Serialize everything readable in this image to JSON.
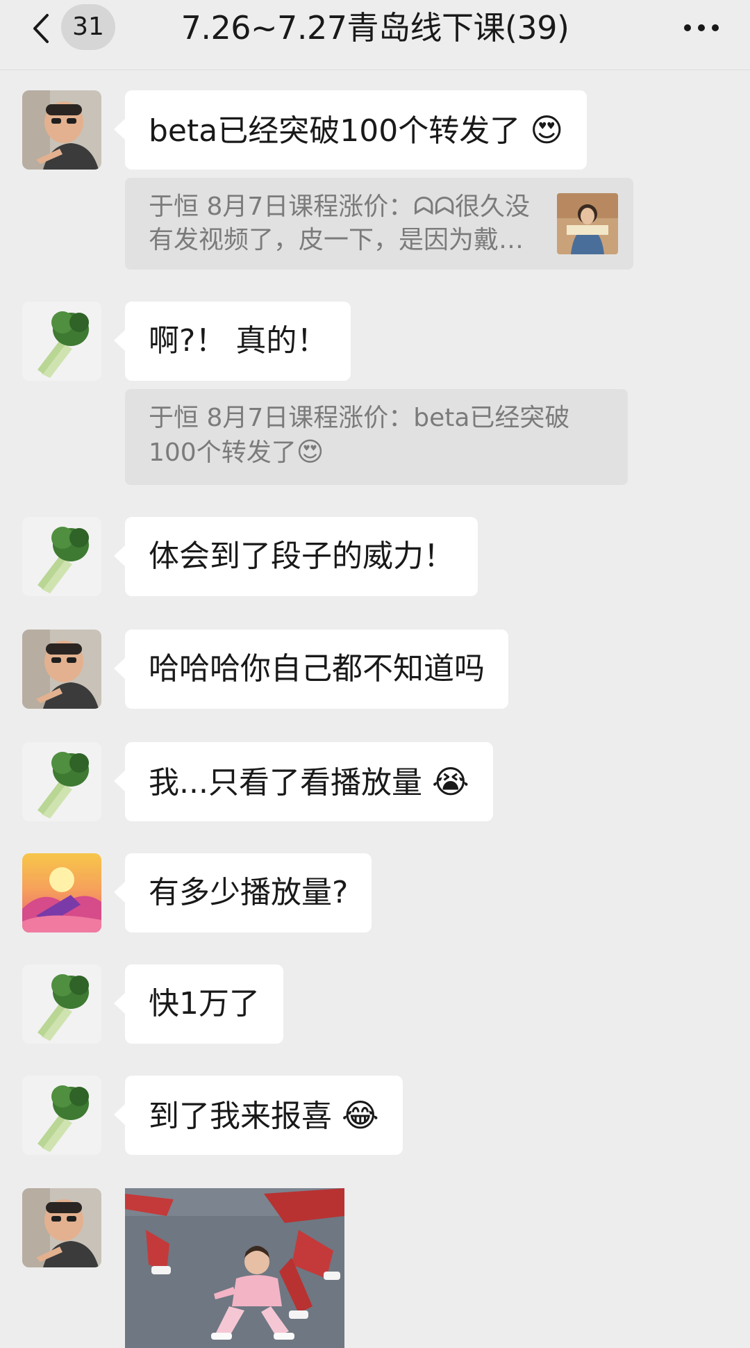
{
  "header": {
    "unread_count": "31",
    "title": "7.26~7.27青岛线下课(39)"
  },
  "messages": [
    {
      "sender": "person",
      "text": "beta已经突破100个转发了",
      "emoji": "😍"
    },
    {
      "sender": "vegetable",
      "text": "啊?！ 真的！"
    },
    {
      "sender": "vegetable",
      "text": "体会到了段子的威力！"
    },
    {
      "sender": "person",
      "text": "哈哈哈你自己都不知道吗"
    },
    {
      "sender": "vegetable",
      "text": "我...只看了看播放量",
      "emoji": "😭"
    },
    {
      "sender": "sunset",
      "text": "有多少播放量?"
    },
    {
      "sender": "vegetable",
      "text": "快1万了"
    },
    {
      "sender": "vegetable",
      "text": "到了我来报喜",
      "emoji": "😂"
    },
    {
      "sender": "person",
      "image": "kungfu-photo"
    }
  ],
  "quotes": [
    {
      "text": "于恒  8月7日课程涨价：ᗣᗣ很久没有发视频了，皮一下，是因为戴…"
    },
    {
      "text": "于恒  8月7日课程涨价：beta已经突破100个转发了",
      "emoji": "😍"
    }
  ],
  "icons": {
    "back": "chevron-left-icon",
    "more": "more-dots-icon"
  },
  "colors": {
    "background": "#ededed",
    "bubble": "#ffffff",
    "quote": "#e1e1e1"
  }
}
